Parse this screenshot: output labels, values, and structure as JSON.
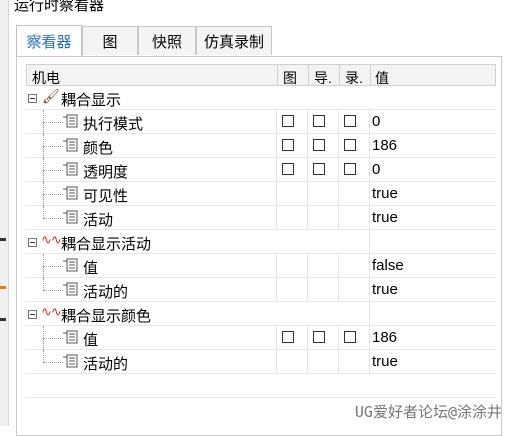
{
  "window": {
    "title": "运行时察看器"
  },
  "tabs": [
    {
      "label": "察看器",
      "active": true
    },
    {
      "label": "图",
      "active": false
    },
    {
      "label": "快照",
      "active": false
    },
    {
      "label": "仿真录制",
      "active": false
    }
  ],
  "columns": {
    "mechanism": "机电",
    "graph": "图",
    "export": "导.",
    "record": "录.",
    "value": "值"
  },
  "tree": {
    "group1": {
      "label": "耦合显示",
      "rows": [
        {
          "label": "执行模式",
          "value": "0"
        },
        {
          "label": "颜色",
          "value": "186"
        },
        {
          "label": "透明度",
          "value": "0"
        },
        {
          "label": "可见性",
          "value": "true"
        },
        {
          "label": "活动",
          "value": "true"
        }
      ]
    },
    "group2": {
      "label": "耦合显示活动",
      "rows": [
        {
          "label": "值",
          "value": "false"
        },
        {
          "label": "活动的",
          "value": "true"
        }
      ]
    },
    "group3": {
      "label": "耦合显示颜色",
      "rows": [
        {
          "label": "值",
          "value": "186"
        },
        {
          "label": "活动的",
          "value": "true"
        }
      ]
    }
  },
  "watermark": "UG爱好者论坛@涂涂井",
  "colors": {
    "active_tab": "#2a6fb0",
    "wave_icon": "#c0392b"
  }
}
